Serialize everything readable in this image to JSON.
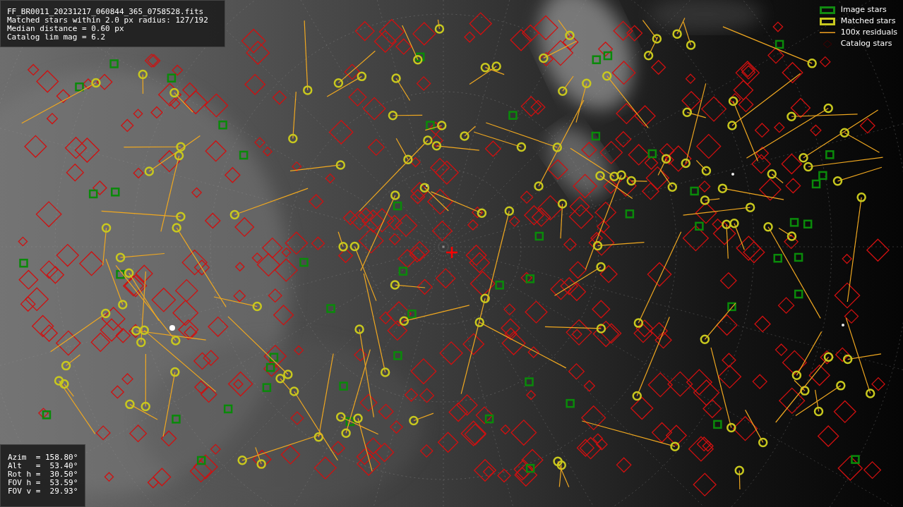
{
  "image": {
    "kind": "picture"
  },
  "info_lines": [
    "FF_BR0011_20231217_060844_365_0758528.fits",
    "Matched stars within 2.0 px radius: 127/192",
    "Median distance = 0.60 px",
    "Catalog lim mag = 6.2"
  ],
  "legend": [
    {
      "label": "Image stars"
    },
    {
      "kind": "matched",
      "label": "Matched stars"
    },
    {
      "kind": "residual",
      "label": "100x residuals"
    },
    {
      "kind": "catalog",
      "label": "Catalog stars"
    }
  ],
  "pointing_lines": [
    "Azim  = 158.80°",
    "Alt   =  53.40°",
    "Rot h =  30.50°",
    "FOV h =  53.59°",
    "FOV v =  29.93°"
  ]
}
